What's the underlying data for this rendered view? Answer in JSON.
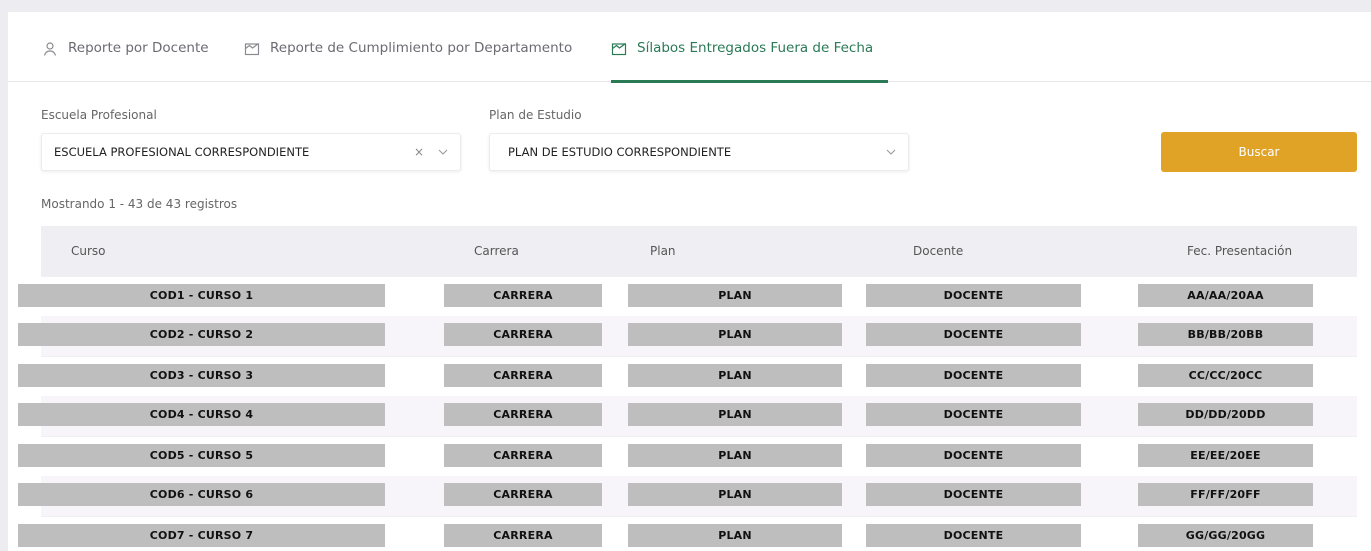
{
  "tabs": [
    {
      "label": "Reporte por Docente",
      "icon": "user-icon",
      "active": false
    },
    {
      "label": "Reporte de Cumplimiento por Departamento",
      "icon": "chart-icon",
      "active": false
    },
    {
      "label": "Sílabos Entregados Fuera de Fecha",
      "icon": "chart-icon",
      "active": true
    }
  ],
  "filters": {
    "escuela": {
      "label": "Escuela Profesional",
      "value": "ESCUELA PROFESIONAL CORRESPONDIENTE",
      "clear": "×"
    },
    "plan": {
      "label": "Plan de Estudio",
      "value": "PLAN DE ESTUDIO CORRESPONDIENTE"
    },
    "search_button": "Buscar"
  },
  "results_count": "Mostrando 1 - 43 de 43 registros",
  "table": {
    "headers": {
      "curso": "Curso",
      "carrera": "Carrera",
      "plan": "Plan",
      "docente": "Docente",
      "fecha": "Fec. Presentación"
    },
    "rows": [
      {
        "curso": "COD1 - CURSO 1",
        "carrera": "CARRERA",
        "plan": "PLAN",
        "docente": "DOCENTE",
        "fecha": "AA/AA/20AA"
      },
      {
        "curso": "COD2 - CURSO 2",
        "carrera": "CARRERA",
        "plan": "PLAN",
        "docente": "DOCENTE",
        "fecha": "BB/BB/20BB"
      },
      {
        "curso": "COD3 - CURSO 3",
        "carrera": "CARRERA",
        "plan": "PLAN",
        "docente": "DOCENTE",
        "fecha": "CC/CC/20CC"
      },
      {
        "curso": "COD4 - CURSO 4",
        "carrera": "CARRERA",
        "plan": "PLAN",
        "docente": "DOCENTE",
        "fecha": "DD/DD/20DD"
      },
      {
        "curso": "COD5 - CURSO 5",
        "carrera": "CARRERA",
        "plan": "PLAN",
        "docente": "DOCENTE",
        "fecha": "EE/EE/20EE"
      },
      {
        "curso": "COD6 - CURSO 6",
        "carrera": "CARRERA",
        "plan": "PLAN",
        "docente": "DOCENTE",
        "fecha": "FF/FF/20FF"
      },
      {
        "curso": "COD7 - CURSO 7",
        "carrera": "CARRERA",
        "plan": "PLAN",
        "docente": "DOCENTE",
        "fecha": "GG/GG/20GG"
      }
    ]
  },
  "colors": {
    "accent": "#2a7a56",
    "button": "#e0a326",
    "placeholder_block": "#bebebe"
  }
}
